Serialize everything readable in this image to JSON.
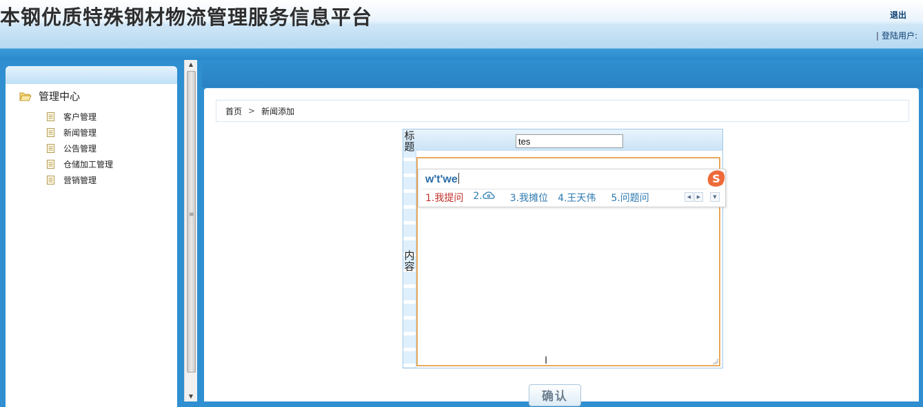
{
  "header": {
    "app_title": "本钢优质特殊钢材物流管理服务信息平台",
    "logout_label": "退出",
    "user_label": "登陆用户:",
    "user_separator": "|"
  },
  "sidebar": {
    "root_label": "管理中心",
    "items": [
      {
        "label": "客户管理"
      },
      {
        "label": "新闻管理"
      },
      {
        "label": "公告管理"
      },
      {
        "label": "仓储加工管理"
      },
      {
        "label": "营销管理"
      }
    ]
  },
  "breadcrumb": {
    "home": "首页",
    "separator": ">",
    "current": "新闻添加"
  },
  "form": {
    "title_label": "标题",
    "title_value": "tes",
    "content_label": "内容",
    "content_value": "",
    "submit_label": "确认"
  },
  "ime": {
    "input_text": "w't'we",
    "candidates": [
      {
        "label": "1.我提问"
      },
      {
        "label": "2."
      },
      {
        "label": "3.我摊位"
      },
      {
        "label": "4.王天伟"
      },
      {
        "label": "5.问题问"
      }
    ],
    "logo_letter": "S"
  },
  "colors": {
    "accent_blue": "#2f8fd0",
    "editor_border": "#e8a85c",
    "candidate_first": "#c0302a",
    "candidate": "#2d7ab0",
    "ime_logo": "#ee6a3a"
  }
}
